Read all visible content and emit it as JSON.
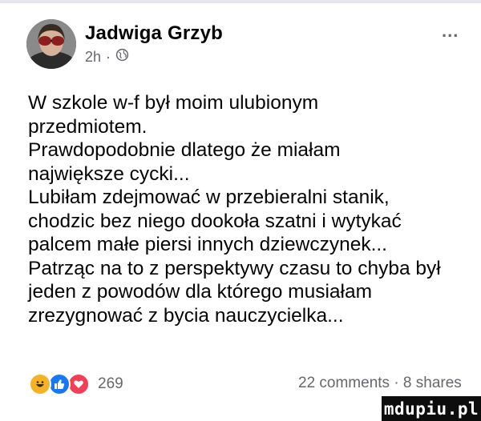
{
  "post": {
    "author": "Jadwiga Grzyb",
    "time": "2h",
    "separator": "·",
    "more_label": "...",
    "lines": [
      "W szkole w-f był moim ulubionym",
      "przedmiotem.",
      "Prawdopodobnie dlatego że miałam",
      "największe cycki...",
      "Lubiłam zdejmować w przebieralni stanik,",
      "chodzic bez niego dookoła szatni i wytykać",
      "palcem małe piersi innych dziewczynek...",
      "Patrząc na to z perspektywy czasu to chyba był",
      "jeden z powodów dla którego musiałam",
      "zrezygnować z bycia nauczycielka..."
    ]
  },
  "footer": {
    "reaction_icons": [
      "haha-icon",
      "like-icon",
      "love-icon"
    ],
    "reaction_count": "269",
    "comments_shares": "22 comments · 8 shares"
  },
  "watermark": "mdupiu.pl",
  "colors": {
    "like": "#1877f2",
    "love": "#f33e58",
    "haha": "#f7b125",
    "secondary_text": "#65676b"
  }
}
